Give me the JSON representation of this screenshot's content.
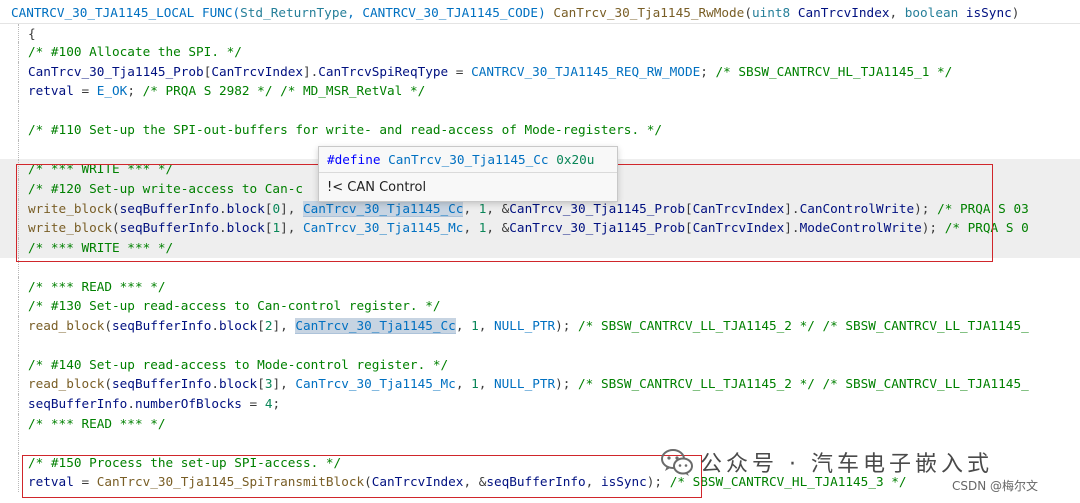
{
  "colors": {
    "keyword": "#0000ff",
    "type": "#267f99",
    "function": "#795e26",
    "variable": "#001080",
    "macro": "#0070c1",
    "number": "#098658",
    "comment": "#008000",
    "highlight_box": "#d0262b"
  },
  "editor": {
    "lines": [
      {
        "indent": 0,
        "tokens": [
          {
            "t": "CANTRCV_30_TJA1145_LOCAL FUNC(",
            "c": "macro"
          },
          {
            "t": "Std_ReturnType",
            "c": "type"
          },
          {
            "t": ", CANTRCV_30_TJA1145_CODE) ",
            "c": "macro"
          },
          {
            "t": "CanTrcv_30_Tja1145_RwMode",
            "c": "func"
          },
          {
            "t": "(",
            "c": "punct"
          },
          {
            "t": "uint8",
            "c": "type"
          },
          {
            "t": " ",
            "c": "punct"
          },
          {
            "t": "CanTrcvIndex",
            "c": "var"
          },
          {
            "t": ", ",
            "c": "punct"
          },
          {
            "t": "boolean",
            "c": "type"
          },
          {
            "t": " ",
            "c": "punct"
          },
          {
            "t": "isSync",
            "c": "var"
          },
          {
            "t": ")",
            "c": "punct"
          }
        ]
      },
      {
        "indent": 1,
        "sep": true,
        "tokens": [
          {
            "t": "{",
            "c": "punct"
          }
        ]
      },
      {
        "indent": 1,
        "tokens": [
          {
            "t": "/* #100 Allocate the SPI. */",
            "c": "comment"
          }
        ]
      },
      {
        "indent": 1,
        "tokens": [
          {
            "t": "CanTrcv_30_Tja1145_Prob",
            "c": "var"
          },
          {
            "t": "[",
            "c": "punct"
          },
          {
            "t": "CanTrcvIndex",
            "c": "var"
          },
          {
            "t": "].",
            "c": "punct"
          },
          {
            "t": "CanTrcvSpiReqType",
            "c": "var"
          },
          {
            "t": " = ",
            "c": "punct"
          },
          {
            "t": "CANTRCV_30_TJA1145_REQ_RW_MODE",
            "c": "macro"
          },
          {
            "t": "; ",
            "c": "punct"
          },
          {
            "t": "/* SBSW_CANTRCV_HL_TJA1145_1 */",
            "c": "comment"
          }
        ]
      },
      {
        "indent": 1,
        "tokens": [
          {
            "t": "retval",
            "c": "var"
          },
          {
            "t": " = ",
            "c": "punct"
          },
          {
            "t": "E_OK",
            "c": "macro"
          },
          {
            "t": "; ",
            "c": "punct"
          },
          {
            "t": "/* PRQA S 2982 */ /* MD_MSR_RetVal */",
            "c": "comment"
          }
        ]
      },
      {
        "indent": 1,
        "tokens": []
      },
      {
        "indent": 1,
        "tokens": [
          {
            "t": "/* #110 Set-up the SPI-out-buffers for write- and read-access of Mode-registers. */",
            "c": "comment"
          }
        ]
      },
      {
        "indent": 1,
        "tokens": []
      },
      {
        "indent": 1,
        "tokens": [
          {
            "t": "/* *** WRITE *** */",
            "c": "comment"
          }
        ]
      },
      {
        "indent": 1,
        "tokens": [
          {
            "t": "/* #120 Set-up write-access to Can-c",
            "c": "comment"
          }
        ]
      },
      {
        "indent": 1,
        "tokens": [
          {
            "t": "write_block",
            "c": "func"
          },
          {
            "t": "(",
            "c": "punct"
          },
          {
            "t": "seqBufferInfo",
            "c": "var"
          },
          {
            "t": ".",
            "c": "punct"
          },
          {
            "t": "block",
            "c": "var"
          },
          {
            "t": "[",
            "c": "punct"
          },
          {
            "t": "0",
            "c": "num"
          },
          {
            "t": "], ",
            "c": "punct"
          },
          {
            "t": "CanTrcv_30_Tja1145_Cc",
            "c": "sel"
          },
          {
            "t": ", ",
            "c": "punct"
          },
          {
            "t": "1",
            "c": "num"
          },
          {
            "t": ", &",
            "c": "punct"
          },
          {
            "t": "CanTrcv_30_Tja1145_Prob",
            "c": "var"
          },
          {
            "t": "[",
            "c": "punct"
          },
          {
            "t": "CanTrcvIndex",
            "c": "var"
          },
          {
            "t": "].",
            "c": "punct"
          },
          {
            "t": "CanControlWrite",
            "c": "var"
          },
          {
            "t": "); ",
            "c": "punct"
          },
          {
            "t": "/* PRQA S 03",
            "c": "comment"
          }
        ]
      },
      {
        "indent": 1,
        "tokens": [
          {
            "t": "write_block",
            "c": "func"
          },
          {
            "t": "(",
            "c": "punct"
          },
          {
            "t": "seqBufferInfo",
            "c": "var"
          },
          {
            "t": ".",
            "c": "punct"
          },
          {
            "t": "block",
            "c": "var"
          },
          {
            "t": "[",
            "c": "punct"
          },
          {
            "t": "1",
            "c": "num"
          },
          {
            "t": "], ",
            "c": "punct"
          },
          {
            "t": "CanTrcv_30_Tja1145_Mc",
            "c": "macro"
          },
          {
            "t": ", ",
            "c": "punct"
          },
          {
            "t": "1",
            "c": "num"
          },
          {
            "t": ", &",
            "c": "punct"
          },
          {
            "t": "CanTrcv_30_Tja1145_Prob",
            "c": "var"
          },
          {
            "t": "[",
            "c": "punct"
          },
          {
            "t": "CanTrcvIndex",
            "c": "var"
          },
          {
            "t": "].",
            "c": "punct"
          },
          {
            "t": "ModeControlWrite",
            "c": "var"
          },
          {
            "t": "); ",
            "c": "punct"
          },
          {
            "t": "/* PRQA S 0",
            "c": "comment"
          }
        ]
      },
      {
        "indent": 1,
        "tokens": [
          {
            "t": "/* *** WRITE *** */",
            "c": "comment"
          }
        ]
      },
      {
        "indent": 1,
        "tokens": []
      },
      {
        "indent": 1,
        "tokens": [
          {
            "t": "/* *** READ *** */",
            "c": "comment"
          }
        ]
      },
      {
        "indent": 1,
        "tokens": [
          {
            "t": "/* #130 Set-up read-access to Can-control register. */",
            "c": "comment"
          }
        ]
      },
      {
        "indent": 1,
        "tokens": [
          {
            "t": "read_block",
            "c": "func"
          },
          {
            "t": "(",
            "c": "punct"
          },
          {
            "t": "seqBufferInfo",
            "c": "var"
          },
          {
            "t": ".",
            "c": "punct"
          },
          {
            "t": "block",
            "c": "var"
          },
          {
            "t": "[",
            "c": "punct"
          },
          {
            "t": "2",
            "c": "num"
          },
          {
            "t": "], ",
            "c": "punct"
          },
          {
            "t": "CanTrcv_30_Tja1145_Cc",
            "c": "sel"
          },
          {
            "t": ", ",
            "c": "punct"
          },
          {
            "t": "1",
            "c": "num"
          },
          {
            "t": ", ",
            "c": "punct"
          },
          {
            "t": "NULL_PTR",
            "c": "macro"
          },
          {
            "t": "); ",
            "c": "punct"
          },
          {
            "t": "/* SBSW_CANTRCV_LL_TJA1145_2 */ /* SBSW_CANTRCV_LL_TJA1145_",
            "c": "comment"
          }
        ]
      },
      {
        "indent": 1,
        "tokens": []
      },
      {
        "indent": 1,
        "tokens": [
          {
            "t": "/* #140 Set-up read-access to Mode-control register. */",
            "c": "comment"
          }
        ]
      },
      {
        "indent": 1,
        "tokens": [
          {
            "t": "read_block",
            "c": "func"
          },
          {
            "t": "(",
            "c": "punct"
          },
          {
            "t": "seqBufferInfo",
            "c": "var"
          },
          {
            "t": ".",
            "c": "punct"
          },
          {
            "t": "block",
            "c": "var"
          },
          {
            "t": "[",
            "c": "punct"
          },
          {
            "t": "3",
            "c": "num"
          },
          {
            "t": "], ",
            "c": "punct"
          },
          {
            "t": "CanTrcv_30_Tja1145_Mc",
            "c": "macro"
          },
          {
            "t": ", ",
            "c": "punct"
          },
          {
            "t": "1",
            "c": "num"
          },
          {
            "t": ", ",
            "c": "punct"
          },
          {
            "t": "NULL_PTR",
            "c": "macro"
          },
          {
            "t": "); ",
            "c": "punct"
          },
          {
            "t": "/* SBSW_CANTRCV_LL_TJA1145_2 */ /* SBSW_CANTRCV_LL_TJA1145_",
            "c": "comment"
          }
        ]
      },
      {
        "indent": 1,
        "tokens": [
          {
            "t": "seqBufferInfo",
            "c": "var"
          },
          {
            "t": ".",
            "c": "punct"
          },
          {
            "t": "numberOfBlocks",
            "c": "var"
          },
          {
            "t": " = ",
            "c": "punct"
          },
          {
            "t": "4",
            "c": "num"
          },
          {
            "t": ";",
            "c": "punct"
          }
        ]
      },
      {
        "indent": 1,
        "tokens": [
          {
            "t": "/* *** READ *** */",
            "c": "comment"
          }
        ]
      },
      {
        "indent": 1,
        "tokens": []
      },
      {
        "indent": 1,
        "tokens": [
          {
            "t": "/* #150 Process the set-up SPI-access. */",
            "c": "comment"
          }
        ]
      },
      {
        "indent": 1,
        "tokens": [
          {
            "t": "retval",
            "c": "var"
          },
          {
            "t": " = ",
            "c": "punct"
          },
          {
            "t": "CanTrcv_30_Tja1145_SpiTransmitBlock",
            "c": "func"
          },
          {
            "t": "(",
            "c": "punct"
          },
          {
            "t": "CanTrcvIndex",
            "c": "var"
          },
          {
            "t": ", &",
            "c": "punct"
          },
          {
            "t": "seqBufferInfo",
            "c": "var"
          },
          {
            "t": ", ",
            "c": "punct"
          },
          {
            "t": "isSync",
            "c": "var"
          },
          {
            "t": "); ",
            "c": "punct"
          },
          {
            "t": "/* SBSW_CANTRCV_HL_TJA1145_3 */",
            "c": "comment"
          }
        ]
      }
    ]
  },
  "hover": {
    "define_keyword": "#define",
    "define_name": "CanTrcv_30_Tja1145_Cc",
    "define_value": "0x20u",
    "doc": "!< CAN Control"
  },
  "watermark": {
    "icon": "wechat-icon",
    "text": "公众号 · 汽车电子嵌入式"
  },
  "credit": "CSDN @梅尔文"
}
